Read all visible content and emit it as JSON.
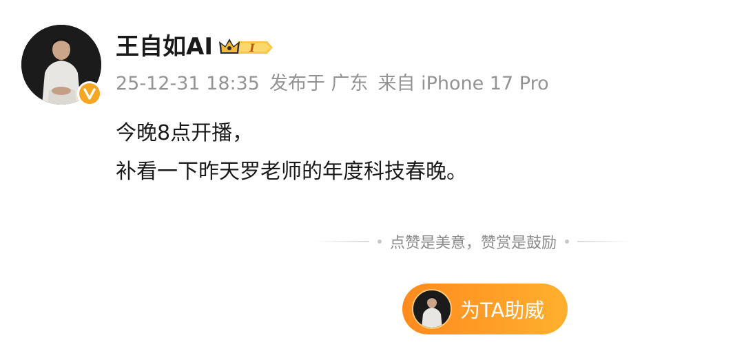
{
  "post": {
    "author": {
      "name": "王自如AI",
      "vip_level": "I",
      "verified_color": "#f5a623"
    },
    "meta": {
      "timestamp": "25-12-31 18:35",
      "location": "发布于 广东",
      "source": "来自 iPhone 17 Pro"
    },
    "content": {
      "line1": "今晚8点开播，",
      "line2": "补看一下昨天罗老师的年度科技春晚。"
    }
  },
  "reward": {
    "tagline": "点赞是美意，赞赏是鼓励",
    "button_label": "为TA助威",
    "button_color": "#ff9a24"
  }
}
